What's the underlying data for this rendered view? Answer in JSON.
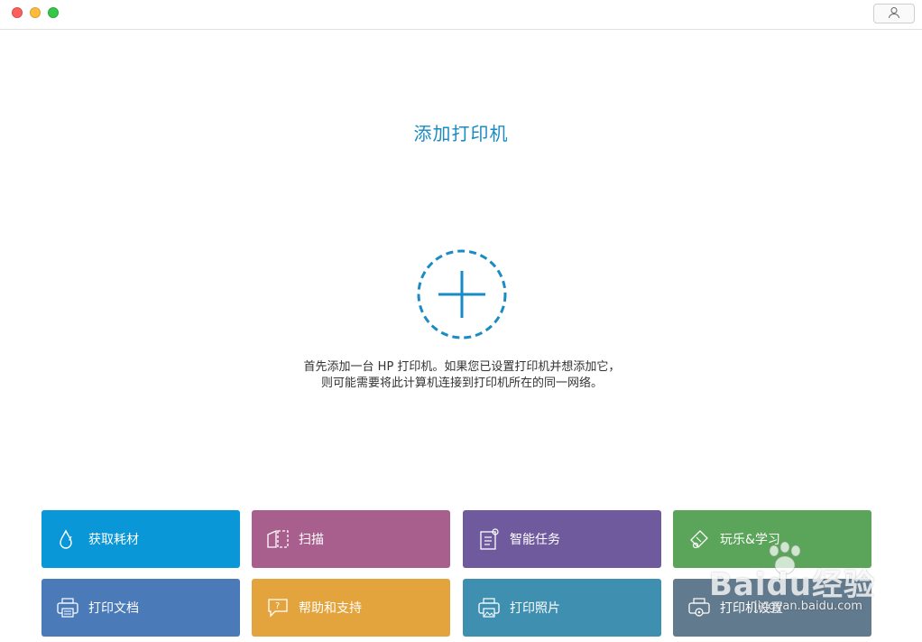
{
  "window": {
    "buttons": [
      "close",
      "minimize",
      "maximize"
    ]
  },
  "header": {
    "account_icon": "person-icon"
  },
  "main": {
    "title": "添加打印机",
    "add_icon": "plus-circle-dashed-icon",
    "description": "首先添加一台 HP 打印机。如果您已设置打印机并想添加它，则可能需要将此计算机连接到打印机所在的同一网络。"
  },
  "tiles": [
    {
      "label": "获取耗材",
      "icon": "ink-drop-icon",
      "color": "#0a97d8"
    },
    {
      "label": "扫描",
      "icon": "scan-icon",
      "color": "#a95f8e"
    },
    {
      "label": "智能任务",
      "icon": "smart-tasks-icon",
      "color": "#6f5a9e"
    },
    {
      "label": "玩乐&学习",
      "icon": "play-learn-icon",
      "color": "#5aa55a"
    },
    {
      "label": "打印文档",
      "icon": "print-document-icon",
      "color": "#4a7ab8"
    },
    {
      "label": "帮助和支持",
      "icon": "help-chat-icon",
      "color": "#e3a43d"
    },
    {
      "label": "打印照片",
      "icon": "print-photo-icon",
      "color": "#3f8fb0"
    },
    {
      "label": "打印机设置",
      "icon": "printer-settings-icon",
      "color": "#617a8e"
    }
  ],
  "watermark": {
    "brand": "Baidu经验",
    "url": "jingyan.baidu.com"
  }
}
